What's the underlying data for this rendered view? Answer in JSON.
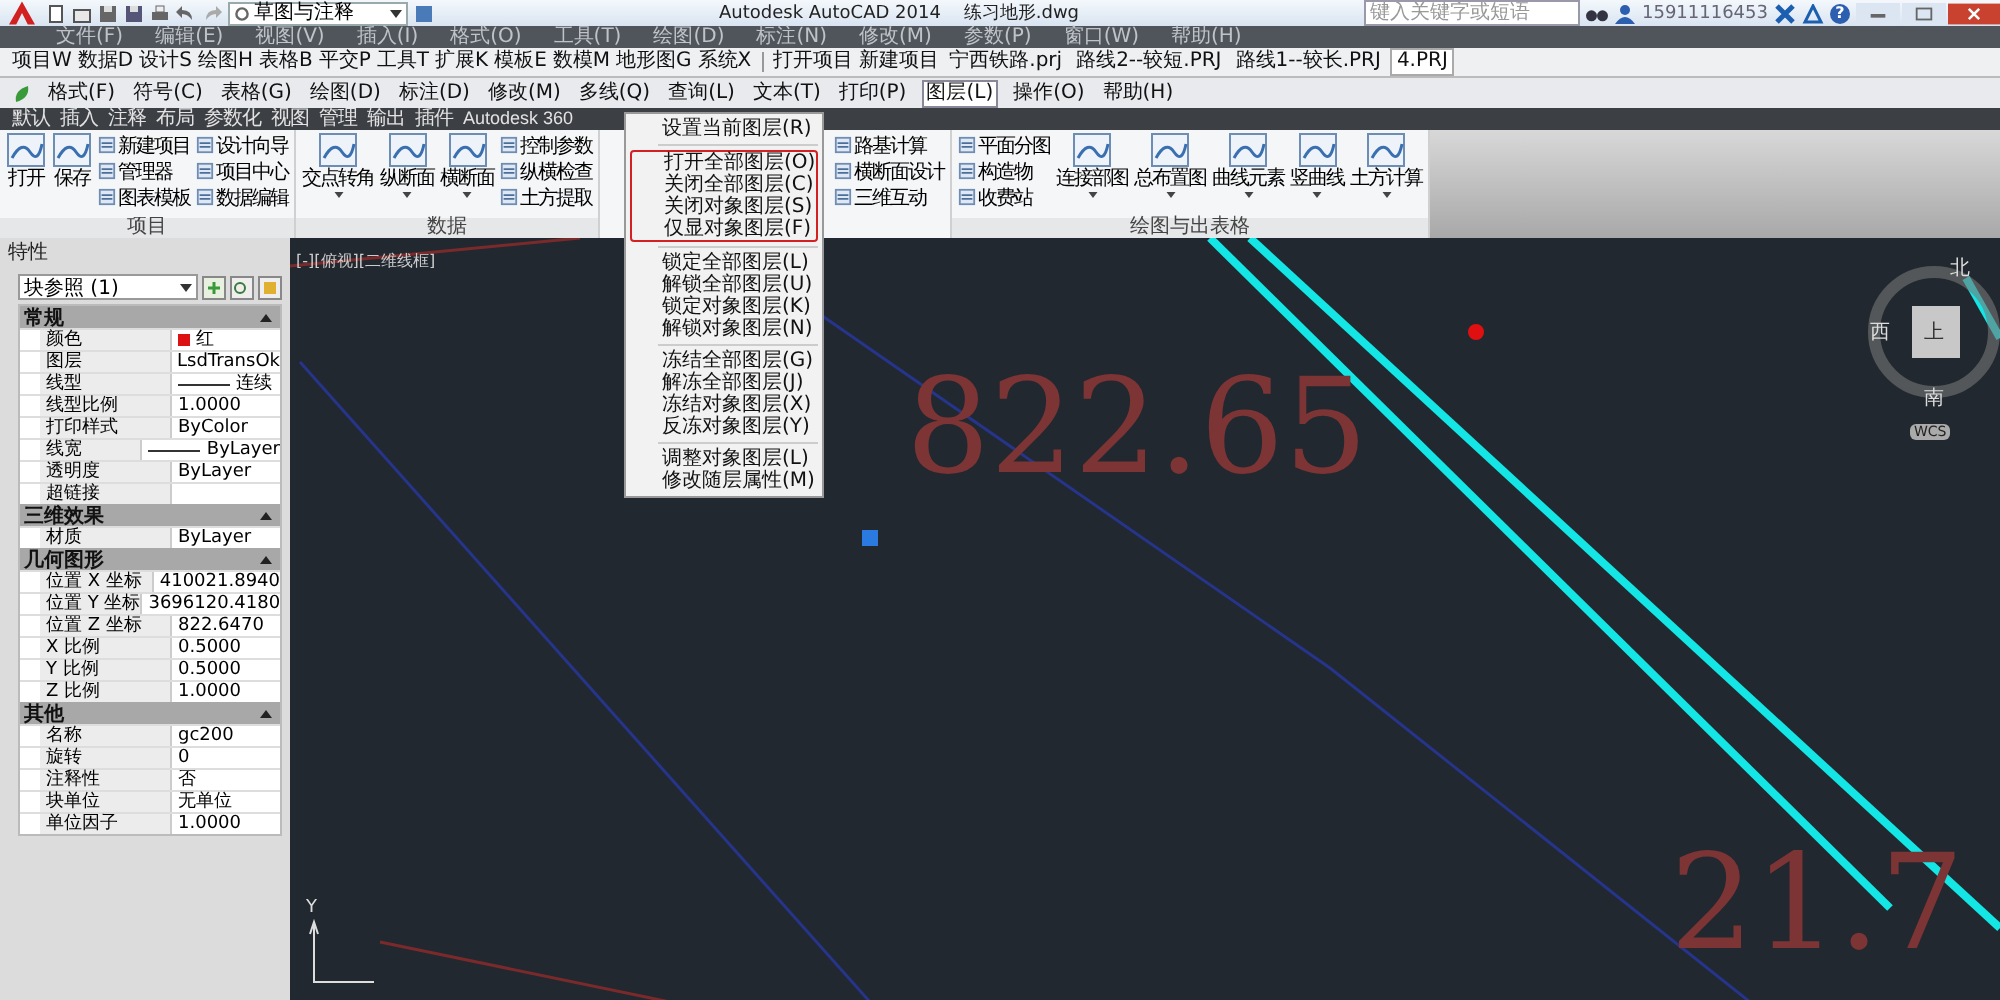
{
  "title_bar": {
    "workspace": "草图与注释",
    "app_title": "Autodesk AutoCAD 2014",
    "file_name": "练习地形.dwg",
    "search": {
      "placeholder": "键入关键字或短语"
    },
    "user": "15911116453",
    "help": "?"
  },
  "menu_bar": [
    "文件(F)",
    "编辑(E)",
    "视图(V)",
    "插入(I)",
    "格式(O)",
    "工具(T)",
    "绘图(D)",
    "标注(N)",
    "修改(M)",
    "参数(P)",
    "窗口(W)",
    "帮助(H)"
  ],
  "toolbar_1": {
    "menus": [
      "项目W",
      "数据D",
      "设计S",
      "绘图H",
      "表格B",
      "平交P",
      "工具T",
      "扩展K",
      "模板E",
      "数模M",
      "地形图G",
      "系统X"
    ],
    "commands": [
      "打开项目",
      "新建项目"
    ],
    "projects": [
      {
        "label": "宁西铁路.prj",
        "selected": false
      },
      {
        "label": "路线2--较短.PRJ",
        "selected": false
      },
      {
        "label": "路线1--较长.PRJ",
        "selected": false
      },
      {
        "label": "4.PRJ",
        "selected": true
      }
    ]
  },
  "toolbar_2": [
    {
      "label": "格式(F)",
      "selected": false
    },
    {
      "label": "符号(C)",
      "selected": false
    },
    {
      "label": "表格(G)",
      "selected": false
    },
    {
      "label": "绘图(D)",
      "selected": false
    },
    {
      "label": "标注(D)",
      "selected": false
    },
    {
      "label": "修改(M)",
      "selected": false
    },
    {
      "label": "多线(Q)",
      "selected": false
    },
    {
      "label": "查询(L)",
      "selected": false
    },
    {
      "label": "文本(T)",
      "selected": false
    },
    {
      "label": "打印(P)",
      "selected": false
    },
    {
      "label": "图层(L)",
      "selected": true
    },
    {
      "label": "操作(O)",
      "selected": false
    },
    {
      "label": "帮助(H)",
      "selected": false
    }
  ],
  "ribbon_tabs": [
    "默认",
    "插入",
    "注释",
    "布局",
    "参数化",
    "视图",
    "管理",
    "输出",
    "插件",
    "Autodesk 360"
  ],
  "ribbon_panels": [
    {
      "title": "项目",
      "tools": [
        {
          "label": "打开",
          "kind": "large",
          "dropdown": false
        },
        {
          "label": "保存",
          "kind": "large",
          "dropdown": false
        },
        {
          "label": "新建项目",
          "kind": "small"
        },
        {
          "label": "管理器",
          "kind": "small"
        },
        {
          "label": "图表模板",
          "kind": "small"
        },
        {
          "label": "设计向导",
          "kind": "small"
        },
        {
          "label": "项目中心",
          "kind": "small"
        },
        {
          "label": "数据编辑",
          "kind": "small"
        }
      ]
    },
    {
      "title": "数据",
      "tools": [
        {
          "label": "交点转角",
          "kind": "large",
          "dropdown": true
        },
        {
          "label": "纵断面",
          "kind": "large",
          "dropdown": true
        },
        {
          "label": "横断面",
          "kind": "large",
          "dropdown": true
        },
        {
          "label": "控制参数",
          "kind": "small"
        },
        {
          "label": "纵横检查",
          "kind": "small"
        },
        {
          "label": "土方提取",
          "kind": "small"
        }
      ]
    },
    {
      "tools": [
        {
          "label": "路基计算",
          "kind": "small"
        },
        {
          "label": "横断面设计",
          "kind": "small"
        },
        {
          "label": "三维互动",
          "kind": "small"
        }
      ]
    },
    {
      "title": "绘图与出表格",
      "tools": [
        {
          "label": "平面分图",
          "kind": "small"
        },
        {
          "label": "构造物",
          "kind": "small"
        },
        {
          "label": "收费站",
          "kind": "small"
        },
        {
          "label": "连接部图",
          "kind": "large",
          "dropdown": true
        },
        {
          "label": "总布置图",
          "kind": "large",
          "dropdown": true
        },
        {
          "label": "曲线元素",
          "kind": "large",
          "dropdown": true
        },
        {
          "label": "竖曲线",
          "kind": "large",
          "dropdown": true
        },
        {
          "label": "土方计算",
          "kind": "large",
          "dropdown": true
        }
      ]
    }
  ],
  "layer_menu": [
    {
      "highlighted": false,
      "items": [
        "设置当前图层(R)"
      ]
    },
    {
      "highlighted": true,
      "items": [
        "打开全部图层(O)",
        "关闭全部图层(C)",
        "关闭对象图层(S)",
        "仅显对象图层(F)"
      ]
    },
    {
      "highlighted": false,
      "items": [
        "锁定全部图层(L)",
        "解锁全部图层(U)",
        "锁定对象图层(K)",
        "解锁对象图层(N)"
      ]
    },
    {
      "highlighted": false,
      "items": [
        "冻结全部图层(G)",
        "解冻全部图层(J)",
        "冻结对象图层(X)",
        "反冻对象图层(Y)"
      ]
    },
    {
      "highlighted": false,
      "items": [
        "调整对象图层(L)",
        "修改随层属性(M)"
      ]
    }
  ],
  "properties": {
    "title": "特性",
    "selector": "块参照 (1)",
    "sections": [
      {
        "title": "常规",
        "expanded": true,
        "rows": [
          {
            "name": "颜色",
            "value": "红",
            "color": "#dd1111"
          },
          {
            "name": "图层",
            "value": "LsdTransOk"
          },
          {
            "name": "线型",
            "value": "连续",
            "kind": "line"
          },
          {
            "name": "线型比例",
            "value": "1.0000"
          },
          {
            "name": "打印样式",
            "value": "ByColor"
          },
          {
            "name": "线宽",
            "value": "ByLayer",
            "kind": "line"
          },
          {
            "name": "透明度",
            "value": "ByLayer"
          },
          {
            "name": "超链接"
          }
        ]
      },
      {
        "title": "三维效果",
        "expanded": true,
        "rows": [
          {
            "name": "材质",
            "value": "ByLayer"
          }
        ]
      },
      {
        "title": "几何图形",
        "expanded": true,
        "rows": [
          {
            "name": "位置 X 坐标",
            "value": "410021.8940"
          },
          {
            "name": "位置 Y 坐标",
            "value": "3696120.4180"
          },
          {
            "name": "位置 Z 坐标",
            "value": "822.6470"
          },
          {
            "name": "X 比例",
            "value": "0.5000"
          },
          {
            "name": "Y 比例",
            "value": "0.5000"
          },
          {
            "name": "Z 比例",
            "value": "1.0000"
          }
        ]
      },
      {
        "title": "其他",
        "expanded": true,
        "rows": [
          {
            "name": "名称",
            "value": "gc200"
          },
          {
            "name": "旋转",
            "value": "0"
          },
          {
            "name": "注释性",
            "value": "否"
          },
          {
            "name": "块单位",
            "value": "无单位"
          },
          {
            "name": "单位因子",
            "value": "1.0000"
          }
        ]
      }
    ]
  },
  "drawing": {
    "viewport_label": "[-][俯视][二维线框]",
    "elevation_labels": [
      "822.65",
      "21.7"
    ],
    "ucs_label": "Y",
    "viewcube": {
      "north": "北",
      "west": "西",
      "south": "南",
      "top": "上",
      "wcs": "WCS"
    }
  }
}
